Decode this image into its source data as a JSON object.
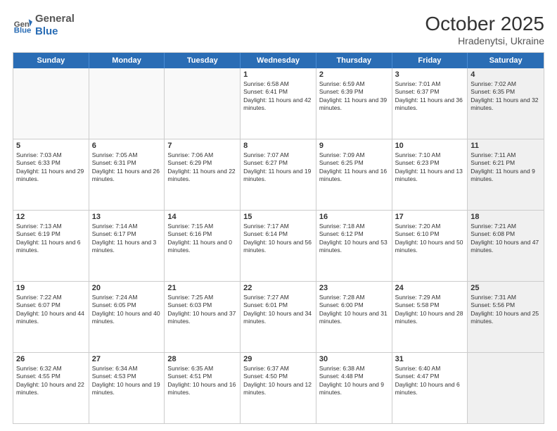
{
  "logo": {
    "general": "General",
    "blue": "Blue"
  },
  "header": {
    "month": "October 2025",
    "location": "Hradenytsi, Ukraine"
  },
  "dayHeaders": [
    "Sunday",
    "Monday",
    "Tuesday",
    "Wednesday",
    "Thursday",
    "Friday",
    "Saturday"
  ],
  "weeks": [
    [
      {
        "num": "",
        "empty": true
      },
      {
        "num": "",
        "empty": true
      },
      {
        "num": "",
        "empty": true
      },
      {
        "num": "1",
        "sunrise": "6:58 AM",
        "sunset": "6:41 PM",
        "daylight": "11 hours and 42 minutes."
      },
      {
        "num": "2",
        "sunrise": "6:59 AM",
        "sunset": "6:39 PM",
        "daylight": "11 hours and 39 minutes."
      },
      {
        "num": "3",
        "sunrise": "7:01 AM",
        "sunset": "6:37 PM",
        "daylight": "11 hours and 36 minutes."
      },
      {
        "num": "4",
        "sunrise": "7:02 AM",
        "sunset": "6:35 PM",
        "daylight": "11 hours and 32 minutes.",
        "shaded": true
      }
    ],
    [
      {
        "num": "5",
        "sunrise": "7:03 AM",
        "sunset": "6:33 PM",
        "daylight": "11 hours and 29 minutes."
      },
      {
        "num": "6",
        "sunrise": "7:05 AM",
        "sunset": "6:31 PM",
        "daylight": "11 hours and 26 minutes."
      },
      {
        "num": "7",
        "sunrise": "7:06 AM",
        "sunset": "6:29 PM",
        "daylight": "11 hours and 22 minutes."
      },
      {
        "num": "8",
        "sunrise": "7:07 AM",
        "sunset": "6:27 PM",
        "daylight": "11 hours and 19 minutes."
      },
      {
        "num": "9",
        "sunrise": "7:09 AM",
        "sunset": "6:25 PM",
        "daylight": "11 hours and 16 minutes."
      },
      {
        "num": "10",
        "sunrise": "7:10 AM",
        "sunset": "6:23 PM",
        "daylight": "11 hours and 13 minutes."
      },
      {
        "num": "11",
        "sunrise": "7:11 AM",
        "sunset": "6:21 PM",
        "daylight": "11 hours and 9 minutes.",
        "shaded": true
      }
    ],
    [
      {
        "num": "12",
        "sunrise": "7:13 AM",
        "sunset": "6:19 PM",
        "daylight": "11 hours and 6 minutes."
      },
      {
        "num": "13",
        "sunrise": "7:14 AM",
        "sunset": "6:17 PM",
        "daylight": "11 hours and 3 minutes."
      },
      {
        "num": "14",
        "sunrise": "7:15 AM",
        "sunset": "6:16 PM",
        "daylight": "11 hours and 0 minutes."
      },
      {
        "num": "15",
        "sunrise": "7:17 AM",
        "sunset": "6:14 PM",
        "daylight": "10 hours and 56 minutes."
      },
      {
        "num": "16",
        "sunrise": "7:18 AM",
        "sunset": "6:12 PM",
        "daylight": "10 hours and 53 minutes."
      },
      {
        "num": "17",
        "sunrise": "7:20 AM",
        "sunset": "6:10 PM",
        "daylight": "10 hours and 50 minutes."
      },
      {
        "num": "18",
        "sunrise": "7:21 AM",
        "sunset": "6:08 PM",
        "daylight": "10 hours and 47 minutes.",
        "shaded": true
      }
    ],
    [
      {
        "num": "19",
        "sunrise": "7:22 AM",
        "sunset": "6:07 PM",
        "daylight": "10 hours and 44 minutes."
      },
      {
        "num": "20",
        "sunrise": "7:24 AM",
        "sunset": "6:05 PM",
        "daylight": "10 hours and 40 minutes."
      },
      {
        "num": "21",
        "sunrise": "7:25 AM",
        "sunset": "6:03 PM",
        "daylight": "10 hours and 37 minutes."
      },
      {
        "num": "22",
        "sunrise": "7:27 AM",
        "sunset": "6:01 PM",
        "daylight": "10 hours and 34 minutes."
      },
      {
        "num": "23",
        "sunrise": "7:28 AM",
        "sunset": "6:00 PM",
        "daylight": "10 hours and 31 minutes."
      },
      {
        "num": "24",
        "sunrise": "7:29 AM",
        "sunset": "5:58 PM",
        "daylight": "10 hours and 28 minutes."
      },
      {
        "num": "25",
        "sunrise": "7:31 AM",
        "sunset": "5:56 PM",
        "daylight": "10 hours and 25 minutes.",
        "shaded": true
      }
    ],
    [
      {
        "num": "26",
        "sunrise": "6:32 AM",
        "sunset": "4:55 PM",
        "daylight": "10 hours and 22 minutes."
      },
      {
        "num": "27",
        "sunrise": "6:34 AM",
        "sunset": "4:53 PM",
        "daylight": "10 hours and 19 minutes."
      },
      {
        "num": "28",
        "sunrise": "6:35 AM",
        "sunset": "4:51 PM",
        "daylight": "10 hours and 16 minutes."
      },
      {
        "num": "29",
        "sunrise": "6:37 AM",
        "sunset": "4:50 PM",
        "daylight": "10 hours and 12 minutes."
      },
      {
        "num": "30",
        "sunrise": "6:38 AM",
        "sunset": "4:48 PM",
        "daylight": "10 hours and 9 minutes."
      },
      {
        "num": "31",
        "sunrise": "6:40 AM",
        "sunset": "4:47 PM",
        "daylight": "10 hours and 6 minutes."
      },
      {
        "num": "",
        "empty": true,
        "shaded": true
      }
    ]
  ]
}
